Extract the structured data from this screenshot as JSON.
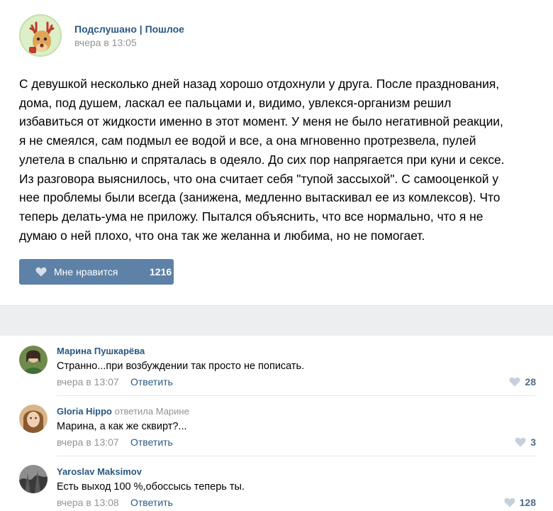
{
  "post": {
    "group_name": "Подслушано | Пошлое",
    "time": "вчера в 13:05",
    "text_lines": [
      "С девушкой несколько дней назад хорошо отдохнули у друга. После празднования,",
      "дома, под душем, ласкал ее пальцами и, видимо, увлекся-организм решил",
      "избавиться от жидкости именно в этот момент. У меня не было негативной реакции,",
      "я не смеялся, сам подмыл ее водой и все, а она мгновенно протрезвела, пулей",
      "улетела в спальню и спряталась в одеяло. До сих пор напрягается при куни и сексе.",
      "Из разговора выяснилось, что она считает себя \"тупой зассыхой\". С самооценкой у",
      "нее проблемы были всегда (занижена, медленно вытаскивал ее из комлексов). Что",
      "теперь делать-ума не приложу. Пытался объяснить, что все нормально, что я не",
      "думаю о ней плохо, что она так же желанна и любима, но не помогает."
    ],
    "like_label": "Мне нравится",
    "like_count": "1216"
  },
  "comments": [
    {
      "author": "Марина Пушкарёва",
      "reply_to": "",
      "text": "Странно...при возбуждении так просто не пописать.",
      "time": "вчера в 13:07",
      "reply_label": "Ответить",
      "likes": "28"
    },
    {
      "author": "Gloria Hippo",
      "reply_to": "ответила Марине",
      "text": "Марина, а как же сквирт?...",
      "time": "вчера в 13:07",
      "reply_label": "Ответить",
      "likes": "3"
    },
    {
      "author": "Yaroslav Maksimov",
      "reply_to": "",
      "text": "Есть выход 100 %,обоссысь теперь ты.",
      "time": "вчера в 13:08",
      "reply_label": "Ответить",
      "likes": "128"
    }
  ],
  "colors": {
    "link": "#2a5885",
    "muted": "#939393",
    "like_button": "#5e81a8",
    "like_heart_muted": "#c5d0db"
  }
}
